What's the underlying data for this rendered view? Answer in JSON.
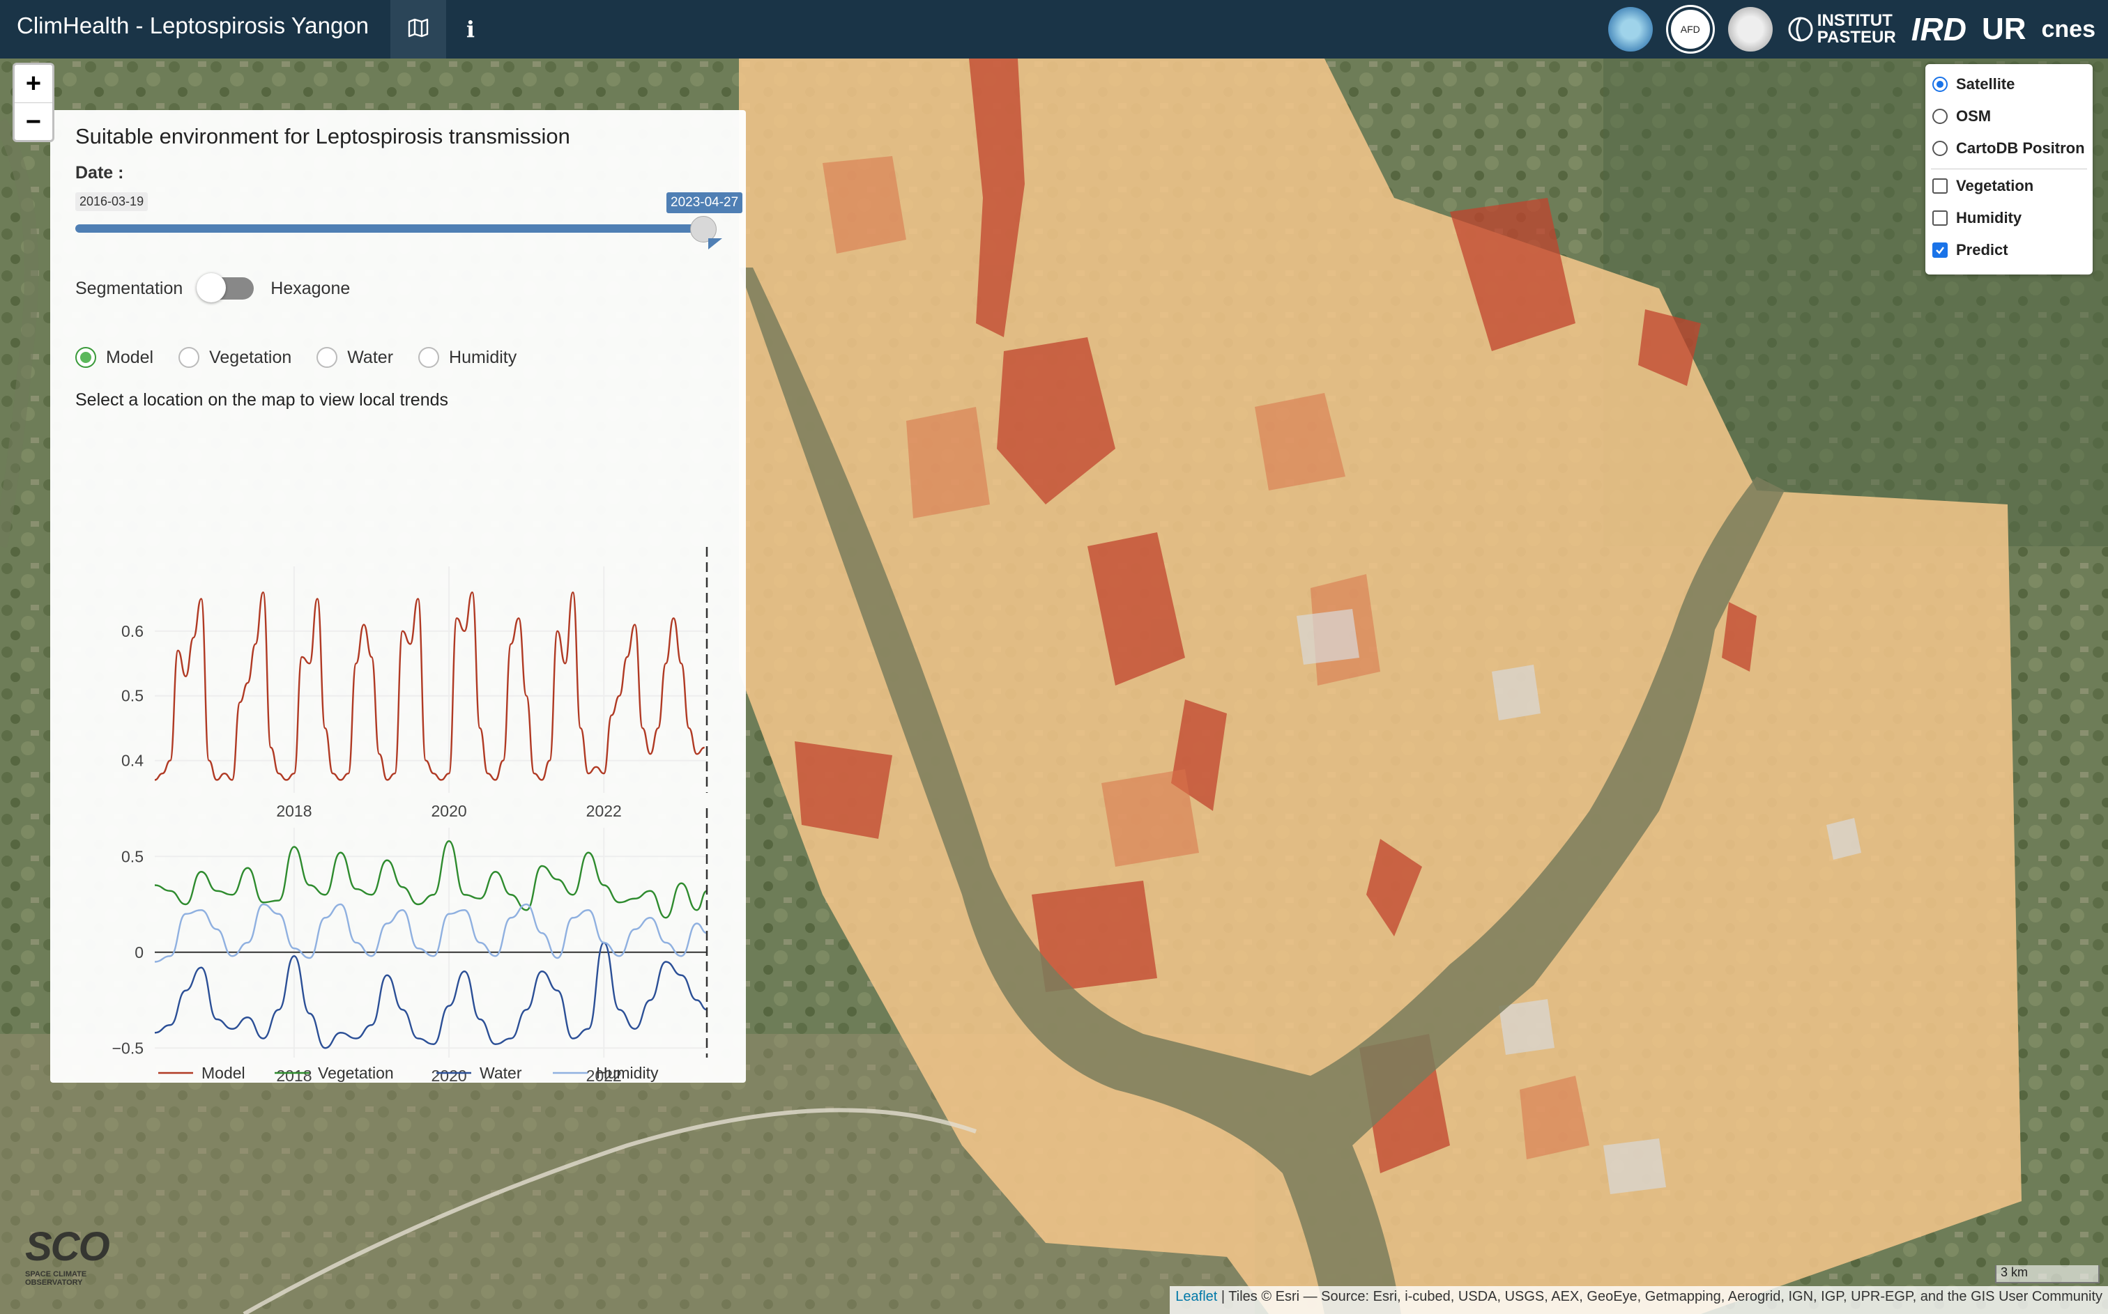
{
  "navbar": {
    "title": "ClimHealth - Leptospirosis Yangon",
    "map_icon": "map-icon",
    "info_label": "i",
    "logos": {
      "afd": "AFD",
      "pasteur": "INSTITUT\nPASTEUR",
      "ird": "IRD",
      "ur": "UR",
      "cnes": "cnes"
    }
  },
  "panel": {
    "title": "Suitable environment for Leptospirosis transmission",
    "date_label": "Date :",
    "date_min": "2016-03-19",
    "date_max": "2023-04-27",
    "toggle_left": "Segmentation",
    "toggle_right": "Hexagone",
    "toggle_state": "segmentation",
    "radios": [
      {
        "label": "Model",
        "selected": true
      },
      {
        "label": "Vegetation",
        "selected": false
      },
      {
        "label": "Water",
        "selected": false
      },
      {
        "label": "Humidity",
        "selected": false
      }
    ],
    "hint": "Select a location on the map to view local trends"
  },
  "layers": {
    "base": [
      {
        "label": "Satellite",
        "selected": true
      },
      {
        "label": "OSM",
        "selected": false
      },
      {
        "label": "CartoDB Positron",
        "selected": false
      }
    ],
    "overlays": [
      {
        "label": "Vegetation",
        "checked": false
      },
      {
        "label": "Humidity",
        "checked": false
      },
      {
        "label": "Predict",
        "checked": true
      }
    ]
  },
  "zoom": {
    "in": "+",
    "out": "−"
  },
  "scale": "3 km",
  "attribution": {
    "leaflet": "Leaflet",
    "text": " | Tiles © Esri — Source: Esri, i-cubed, USDA, USGS, AEX, GeoEye, Getmapping, Aerogrid, IGN, IGP, UPR-EGP, and the GIS User Community"
  },
  "sco_logo": {
    "big": "SCO",
    "small": "SPACE CLIMATE\nOBSERVATORY"
  },
  "colors": {
    "navbar": "#1a3447",
    "slider": "#4f7fb4",
    "model": "#b03a24",
    "vegetation": "#2e8b2e",
    "water": "#2b4f96",
    "humidity": "#8fb0e0",
    "map_suitable_low": "#f1c58a",
    "map_suitable_high": "#c0442e"
  },
  "chart_data": [
    {
      "type": "line",
      "title": "",
      "xlabel": "",
      "ylabel": "",
      "xlim": [
        2016.2,
        2023.33
      ],
      "ylim": [
        0.35,
        0.7
      ],
      "xticks": [
        2018,
        2020,
        2022
      ],
      "xtick_labels": [
        "2018",
        "2020",
        "2022"
      ],
      "yticks": [
        0.4,
        0.5,
        0.6
      ],
      "ytick_labels": [
        "0.4",
        "0.5",
        "0.6"
      ],
      "vline_x": 2023.33,
      "series": [
        {
          "name": "Model",
          "x": [
            2016.2,
            2016.3,
            2016.4,
            2016.5,
            2016.6,
            2016.7,
            2016.8,
            2016.9,
            2017.0,
            2017.1,
            2017.2,
            2017.3,
            2017.4,
            2017.5,
            2017.6,
            2017.7,
            2017.8,
            2017.9,
            2018.0,
            2018.1,
            2018.2,
            2018.3,
            2018.4,
            2018.5,
            2018.6,
            2018.7,
            2018.8,
            2018.9,
            2019.0,
            2019.1,
            2019.2,
            2019.3,
            2019.4,
            2019.5,
            2019.6,
            2019.7,
            2019.8,
            2019.9,
            2020.0,
            2020.1,
            2020.2,
            2020.3,
            2020.4,
            2020.5,
            2020.6,
            2020.7,
            2020.8,
            2020.9,
            2021.0,
            2021.1,
            2021.2,
            2021.3,
            2021.4,
            2021.5,
            2021.6,
            2021.7,
            2021.8,
            2021.9,
            2022.0,
            2022.1,
            2022.2,
            2022.3,
            2022.4,
            2022.5,
            2022.6,
            2022.7,
            2022.8,
            2022.9,
            2023.0,
            2023.1,
            2023.2,
            2023.3
          ],
          "y": [
            0.37,
            0.38,
            0.4,
            0.57,
            0.53,
            0.59,
            0.65,
            0.4,
            0.37,
            0.38,
            0.37,
            0.49,
            0.52,
            0.58,
            0.66,
            0.42,
            0.38,
            0.37,
            0.38,
            0.56,
            0.55,
            0.65,
            0.45,
            0.38,
            0.37,
            0.38,
            0.55,
            0.61,
            0.56,
            0.41,
            0.37,
            0.38,
            0.6,
            0.58,
            0.65,
            0.4,
            0.38,
            0.37,
            0.38,
            0.62,
            0.6,
            0.66,
            0.45,
            0.38,
            0.37,
            0.4,
            0.58,
            0.62,
            0.5,
            0.38,
            0.37,
            0.4,
            0.6,
            0.55,
            0.66,
            0.45,
            0.38,
            0.39,
            0.38,
            0.47,
            0.5,
            0.56,
            0.61,
            0.45,
            0.41,
            0.45,
            0.55,
            0.62,
            0.55,
            0.45,
            0.41,
            0.42
          ]
        }
      ]
    },
    {
      "type": "line",
      "title": "",
      "xlabel": "",
      "ylabel": "",
      "xlim": [
        2016.2,
        2023.33
      ],
      "ylim": [
        -0.55,
        0.65
      ],
      "xticks": [
        2018,
        2020,
        2022
      ],
      "xtick_labels": [
        "2018",
        "2020",
        "2022"
      ],
      "yticks": [
        -0.5,
        0,
        0.5
      ],
      "ytick_labels": [
        "−0.5",
        "0",
        "0.5"
      ],
      "vline_x": 2023.33,
      "zero_line": true,
      "legend": "bottom",
      "series": [
        {
          "name": "Vegetation",
          "x": [
            2016.2,
            2016.4,
            2016.6,
            2016.8,
            2017.0,
            2017.2,
            2017.4,
            2017.6,
            2017.8,
            2018.0,
            2018.2,
            2018.4,
            2018.6,
            2018.8,
            2019.0,
            2019.2,
            2019.4,
            2019.6,
            2019.8,
            2020.0,
            2020.2,
            2020.4,
            2020.6,
            2020.8,
            2021.0,
            2021.2,
            2021.4,
            2021.6,
            2021.8,
            2022.0,
            2022.2,
            2022.4,
            2022.6,
            2022.8,
            2023.0,
            2023.2,
            2023.33
          ],
          "y": [
            0.35,
            0.32,
            0.25,
            0.42,
            0.32,
            0.3,
            0.44,
            0.26,
            0.27,
            0.55,
            0.35,
            0.3,
            0.52,
            0.33,
            0.3,
            0.48,
            0.34,
            0.25,
            0.3,
            0.58,
            0.3,
            0.28,
            0.42,
            0.3,
            0.22,
            0.45,
            0.38,
            0.3,
            0.52,
            0.35,
            0.26,
            0.28,
            0.32,
            0.18,
            0.36,
            0.22,
            0.32
          ]
        },
        {
          "name": "Water",
          "x": [
            2016.2,
            2016.4,
            2016.6,
            2016.8,
            2017.0,
            2017.2,
            2017.4,
            2017.6,
            2017.8,
            2018.0,
            2018.2,
            2018.4,
            2018.6,
            2018.8,
            2019.0,
            2019.2,
            2019.4,
            2019.6,
            2019.8,
            2020.0,
            2020.2,
            2020.4,
            2020.6,
            2020.8,
            2021.0,
            2021.2,
            2021.4,
            2021.6,
            2021.8,
            2022.0,
            2022.2,
            2022.4,
            2022.6,
            2022.8,
            2023.0,
            2023.2,
            2023.33
          ],
          "y": [
            -0.42,
            -0.38,
            -0.2,
            -0.08,
            -0.35,
            -0.4,
            -0.34,
            -0.45,
            -0.3,
            -0.02,
            -0.32,
            -0.5,
            -0.42,
            -0.45,
            -0.38,
            -0.12,
            -0.3,
            -0.45,
            -0.48,
            -0.28,
            -0.1,
            -0.35,
            -0.48,
            -0.45,
            -0.3,
            -0.1,
            -0.2,
            -0.45,
            -0.4,
            0.05,
            -0.3,
            -0.4,
            -0.25,
            -0.05,
            -0.12,
            -0.25,
            -0.3
          ]
        },
        {
          "name": "Humidity",
          "x": [
            2016.2,
            2016.4,
            2016.6,
            2016.8,
            2017.0,
            2017.2,
            2017.4,
            2017.6,
            2017.8,
            2018.0,
            2018.2,
            2018.4,
            2018.6,
            2018.8,
            2019.0,
            2019.2,
            2019.4,
            2019.6,
            2019.8,
            2020.0,
            2020.2,
            2020.4,
            2020.6,
            2020.8,
            2021.0,
            2021.2,
            2021.4,
            2021.6,
            2021.8,
            2022.0,
            2022.2,
            2022.4,
            2022.6,
            2022.8,
            2023.0,
            2023.2,
            2023.33
          ],
          "y": [
            -0.05,
            -0.02,
            0.2,
            0.22,
            0.12,
            -0.02,
            0.05,
            0.25,
            0.2,
            0.02,
            -0.03,
            0.18,
            0.25,
            0.05,
            -0.02,
            0.15,
            0.22,
            0.02,
            -0.02,
            0.2,
            0.22,
            0.05,
            -0.02,
            0.18,
            0.25,
            0.1,
            -0.03,
            0.18,
            0.22,
            0.05,
            -0.02,
            0.12,
            0.18,
            0.05,
            -0.02,
            0.15,
            0.1
          ]
        }
      ],
      "legend_series": [
        "Model",
        "Vegetation",
        "Water",
        "Humidity"
      ]
    }
  ]
}
